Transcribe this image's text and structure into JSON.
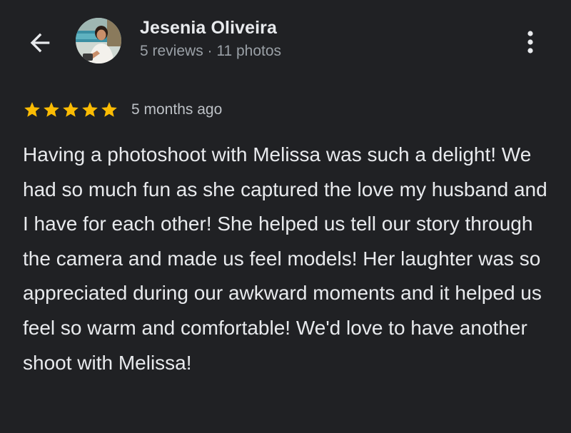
{
  "header": {
    "back_icon": "arrow-left-icon",
    "more_icon": "more-vertical-icon",
    "reviewer": {
      "name": "Jesenia Oliveira",
      "meta": "5 reviews · 11 photos",
      "avatar": "profile-photo"
    }
  },
  "review": {
    "rating": 5,
    "rating_max": 5,
    "star_icon": "star-icon",
    "star_color": "#fbbc04",
    "date": "5 months ago",
    "text": "Having a photoshoot with Melissa was such a delight! We had so much fun as she captured the love my husband and I have for each other! She helped us tell our story through the camera and made us feel models! Her laughter was so appreciated during our awkward moments and it helped us feel so warm and comfortable! We'd love to have another shoot with Melissa!"
  },
  "colors": {
    "background": "#202124",
    "primary_text": "#e8eaed",
    "secondary_text": "#9aa0a6"
  }
}
